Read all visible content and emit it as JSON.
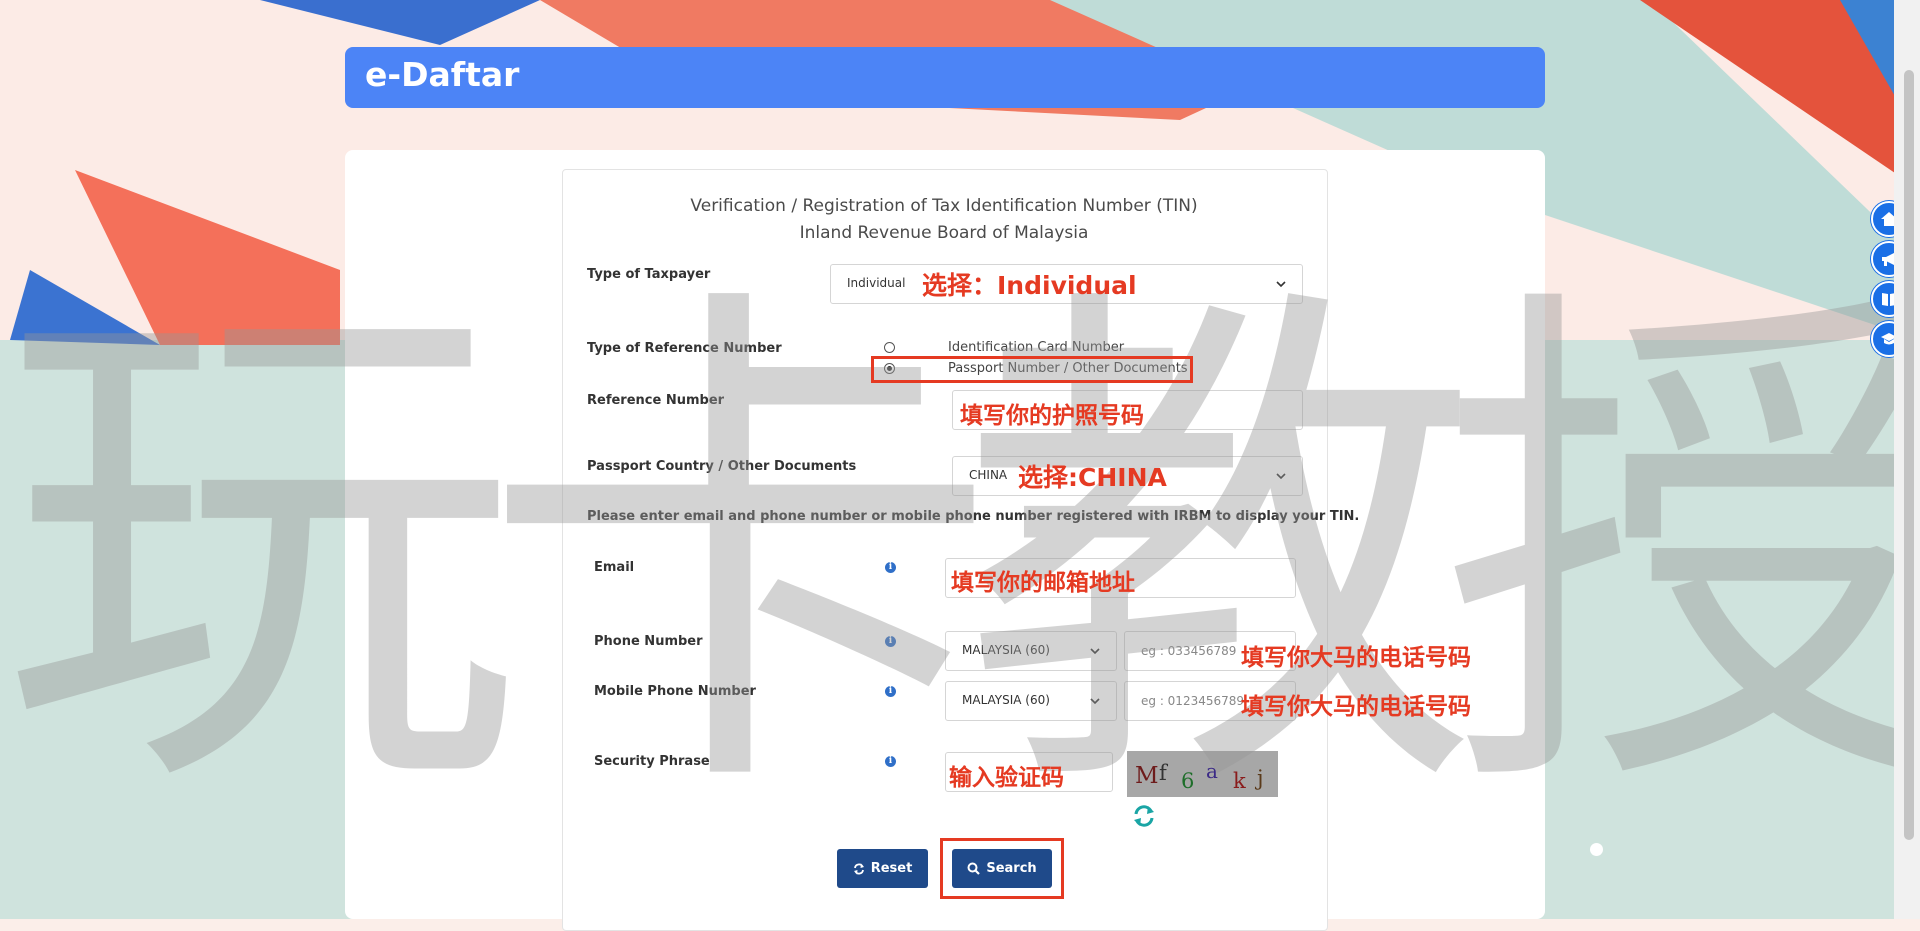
{
  "app": {
    "title": "e-Daftar"
  },
  "form": {
    "title_line1": "Verification / Registration of Tax Identification Number (TIN)",
    "title_line2": "Inland Revenue Board of Malaysia",
    "taxpayer_type": {
      "label": "Type of Taxpayer",
      "value": "Individual"
    },
    "reference_type": {
      "label": "Type of Reference Number",
      "options": [
        {
          "label": "Identification Card Number",
          "selected": false
        },
        {
          "label": "Passport Number / Other Documents",
          "selected": true
        }
      ]
    },
    "reference_number": {
      "label": "Reference Number",
      "value": ""
    },
    "passport_country": {
      "label": "Passport Country / Other Documents",
      "value": "CHINA"
    },
    "notice": "Please enter email and phone number or mobile phone number registered with IRBM to display your TIN.",
    "email": {
      "label": "Email",
      "value": ""
    },
    "phone": {
      "label": "Phone Number",
      "country": "MALAYSIA (60)",
      "placeholder": "eg : 033456789"
    },
    "mobile": {
      "label": "Mobile Phone Number",
      "country": "MALAYSIA (60)",
      "placeholder": "eg : 0123456789"
    },
    "security": {
      "label": "Security Phrase",
      "captcha_chars": [
        "M",
        "f",
        "6",
        "a",
        "k",
        "j"
      ]
    },
    "buttons": {
      "reset": "Reset",
      "search": "Search"
    }
  },
  "annotations": {
    "taxpayer": "选择：Individual",
    "passport": "填写你的护照号码",
    "country": "选择:CHINA",
    "email": "填写你的邮箱地址",
    "phone": "填写你大马的电话号码",
    "mobile": "填写你大马的电话号码",
    "captcha": "输入验证码"
  },
  "watermark": "玩卡教授",
  "side_nav": [
    "home-icon",
    "megaphone-icon",
    "book-icon",
    "graduation-cap-icon"
  ],
  "colors": {
    "header": "#4c84f6",
    "button": "#1f4a8a",
    "annotation": "#e53a22",
    "side_nav": "#1a6fe6"
  }
}
